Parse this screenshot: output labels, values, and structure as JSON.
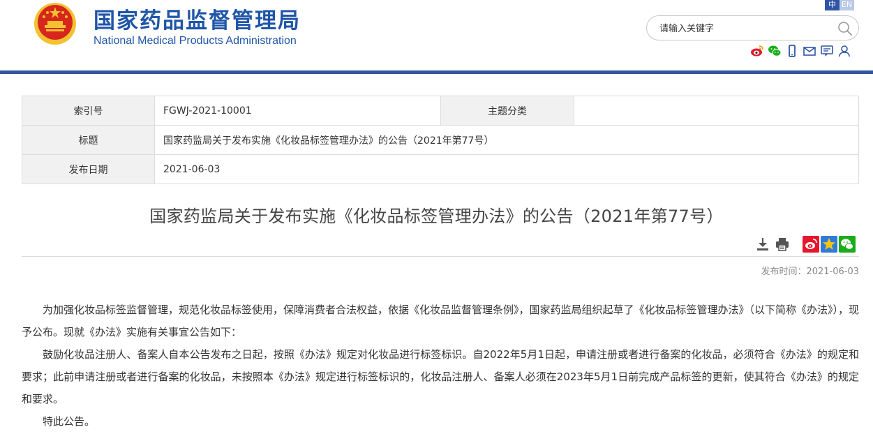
{
  "header": {
    "title_cn": "国家药品监督管理局",
    "title_en": "National Medical Products Administration",
    "lang": {
      "cn": "中",
      "en": "EN"
    },
    "search": {
      "placeholder": "请输入关键字"
    },
    "icons": [
      "weibo-icon",
      "wechat-icon",
      "mobile-icon",
      "mail-icon",
      "message-icon",
      "user-icon"
    ]
  },
  "info": {
    "index_label": "索引号",
    "index_value": "FGWJ-2021-10001",
    "topic_label": "主题分类",
    "topic_value": "",
    "title_label": "标题",
    "title_value": "国家药监局关于发布实施《化妆品标签管理办法》的公告（2021年第77号）",
    "date_label": "发布日期",
    "date_value": "2021-06-03"
  },
  "article": {
    "title": "国家药监局关于发布实施《化妆品标签管理办法》的公告（2021年第77号）",
    "publish_time": "发布时间：2021-06-03",
    "paragraphs": [
      "为加强化妆品标签监督管理，规范化妆品标签使用，保障消费者合法权益，依据《化妆品监督管理条例》，国家药监局组织起草了《化妆品标签管理办法》（以下简称《办法》），现予公布。现就《办法》实施有关事宜公告如下：",
      "鼓励化妆品注册人、备案人自本公告发布之日起，按照《办法》规定对化妆品进行标签标识。自2022年5月1日起，申请注册或者进行备案的化妆品，必须符合《办法》的规定和要求；此前申请注册或者进行备案的化妆品，未按照本《办法》规定进行标签标识的，化妆品注册人、备案人必须在2023年5月1日前完成产品标签的更新，使其符合《办法》的规定和要求。",
      "特此公告。"
    ]
  },
  "colors": {
    "brand_blue": "#2f55a4",
    "title_blue": "#1f55a8",
    "emblem_red": "#d7261b",
    "emblem_gold": "#f2c230"
  }
}
